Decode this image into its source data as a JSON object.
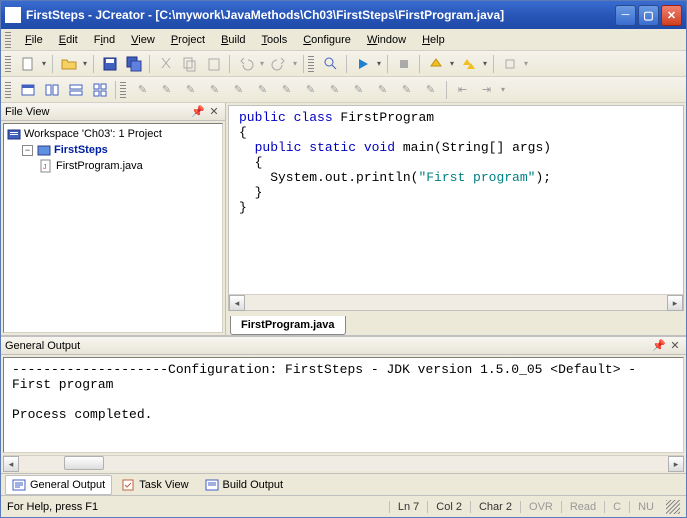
{
  "title": "FirstSteps - JCreator - [C:\\mywork\\JavaMethods\\Ch03\\FirstSteps\\FirstProgram.java]",
  "menu": {
    "file": "File",
    "edit": "Edit",
    "find": "Find",
    "view": "View",
    "project": "Project",
    "build": "Build",
    "tools": "Tools",
    "configure": "Configure",
    "window": "Window",
    "help": "Help"
  },
  "fileview": {
    "title": "File View",
    "workspace": "Workspace 'Ch03': 1 Project",
    "project": "FirstSteps",
    "file": "FirstProgram.java"
  },
  "editor": {
    "tab": "FirstProgram.java",
    "code": {
      "l1a": "public",
      "l1b": " class",
      "l1c": " FirstProgram",
      "l2": "{",
      "l3a": "  public",
      "l3b": " static",
      "l3c": " void",
      "l3d": " main(String[] args)",
      "l4": "  {",
      "l5a": "    System.out.println(",
      "l5b": "\"First program\"",
      "l5c": ");",
      "l6": "  }",
      "l7": "}"
    }
  },
  "output": {
    "title": "General Output",
    "text": "--------------------Configuration: FirstSteps - JDK version 1.5.0_05 <Default> -\nFirst program\n\nProcess completed.",
    "tabs": {
      "general": "General Output",
      "task": "Task View",
      "build": "Build Output"
    }
  },
  "status": {
    "help": "For Help, press F1",
    "ln": "Ln 7",
    "col": "Col 2",
    "char": "Char 2",
    "ovr": "OVR",
    "read": "Read",
    "caps": "C",
    "num": "NU"
  }
}
